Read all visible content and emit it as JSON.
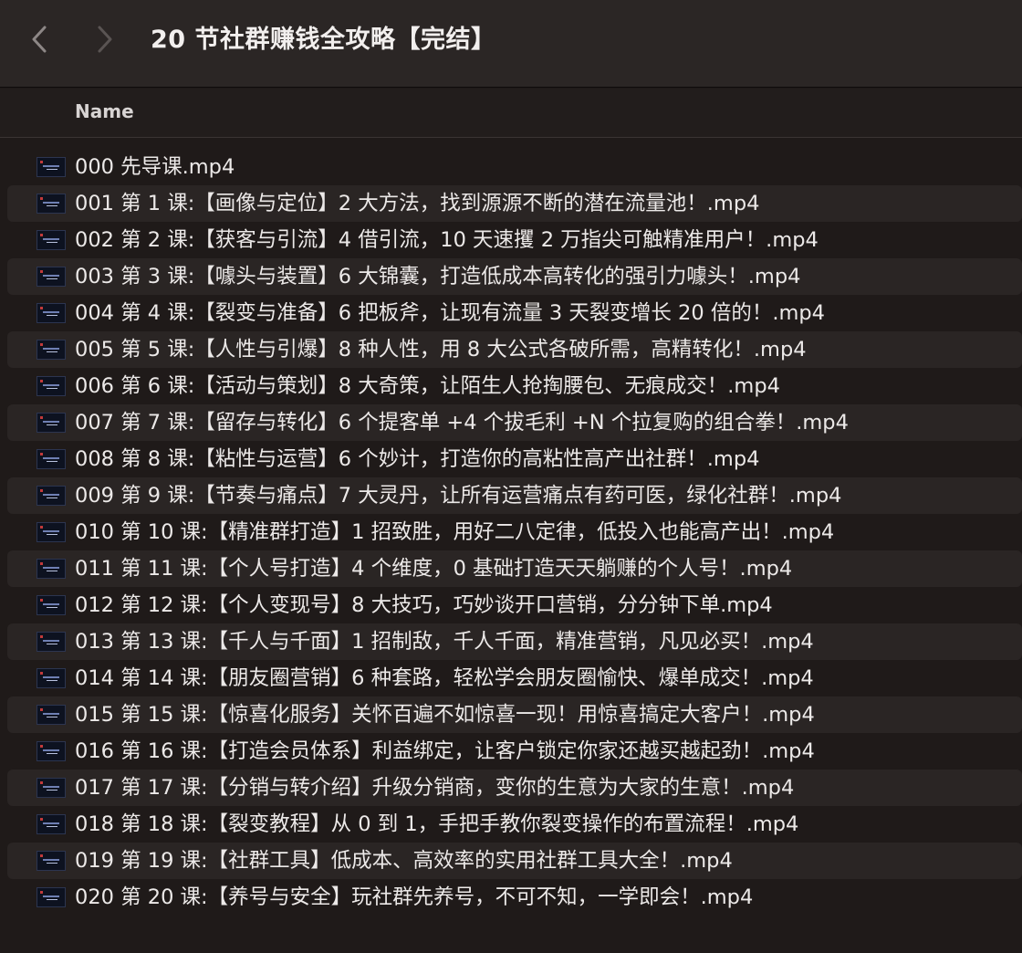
{
  "toolbar": {
    "back_icon": "chevron-left-icon",
    "forward_icon": "chevron-right-icon",
    "title": "20 节社群赚钱全攻略【完结】"
  },
  "header": {
    "name_label": "Name"
  },
  "files": [
    "000 先导课.mp4",
    "001 第 1 课:【画像与定位】2 大方法，找到源源不断的潜在流量池！.mp4",
    "002 第 2 课:【获客与引流】4 借引流，10 天速攫 2 万指尖可触精准用户！.mp4",
    "003 第 3 课:【噱头与装置】6 大锦囊，打造低成本高转化的强引力噱头！.mp4",
    "004 第 4 课:【裂变与准备】6 把板斧，让现有流量 3 天裂变增长 20 倍的！.mp4",
    "005 第 5 课:【人性与引爆】8 种人性，用 8 大公式各破所需，高精转化！.mp4",
    "006 第 6 课:【活动与策划】8 大奇策，让陌生人抢掏腰包、无痕成交！.mp4",
    "007 第 7 课:【留存与转化】6 个提客单 +4 个拔毛利 +N 个拉复购的组合拳！.mp4",
    "008 第 8 课:【粘性与运营】6 个妙计，打造你的高粘性高产出社群！.mp4",
    "009 第 9 课:【节奏与痛点】7 大灵丹，让所有运营痛点有药可医，绿化社群！.mp4",
    "010 第 10 课:【精准群打造】1 招致胜，用好二八定律，低投入也能高产出！.mp4",
    "011 第 11 课:【个人号打造】4 个维度，0 基础打造天天躺赚的个人号！.mp4",
    "012 第 12 课:【个人变现号】8 大技巧，巧妙谈开口营销，分分钟下单.mp4",
    "013 第 13 课:【千人与千面】1 招制敌，千人千面，精准营销，凡见必买！.mp4",
    "014 第 14 课:【朋友圈营销】6 种套路，轻松学会朋友圈愉快、爆单成交！.mp4",
    "015 第 15 课:【惊喜化服务】关怀百遍不如惊喜一现！用惊喜搞定大客户！.mp4",
    "016 第 16 课:【打造会员体系】利益绑定，让客户锁定你家还越买越起劲！.mp4",
    "017 第 17 课:【分销与转介绍】升级分销商，变你的生意为大家的生意！.mp4",
    "018 第 18 课:【裂变教程】从 0 到 1，手把手教你裂变操作的布置流程！.mp4",
    "019 第 19 课:【社群工具】低成本、高效率的实用社群工具大全！.mp4",
    "020 第 20 课:【养号与安全】玩社群先养号，不可不知，一学即会！.mp4"
  ],
  "file_icon": "video-thumbnail-icon"
}
